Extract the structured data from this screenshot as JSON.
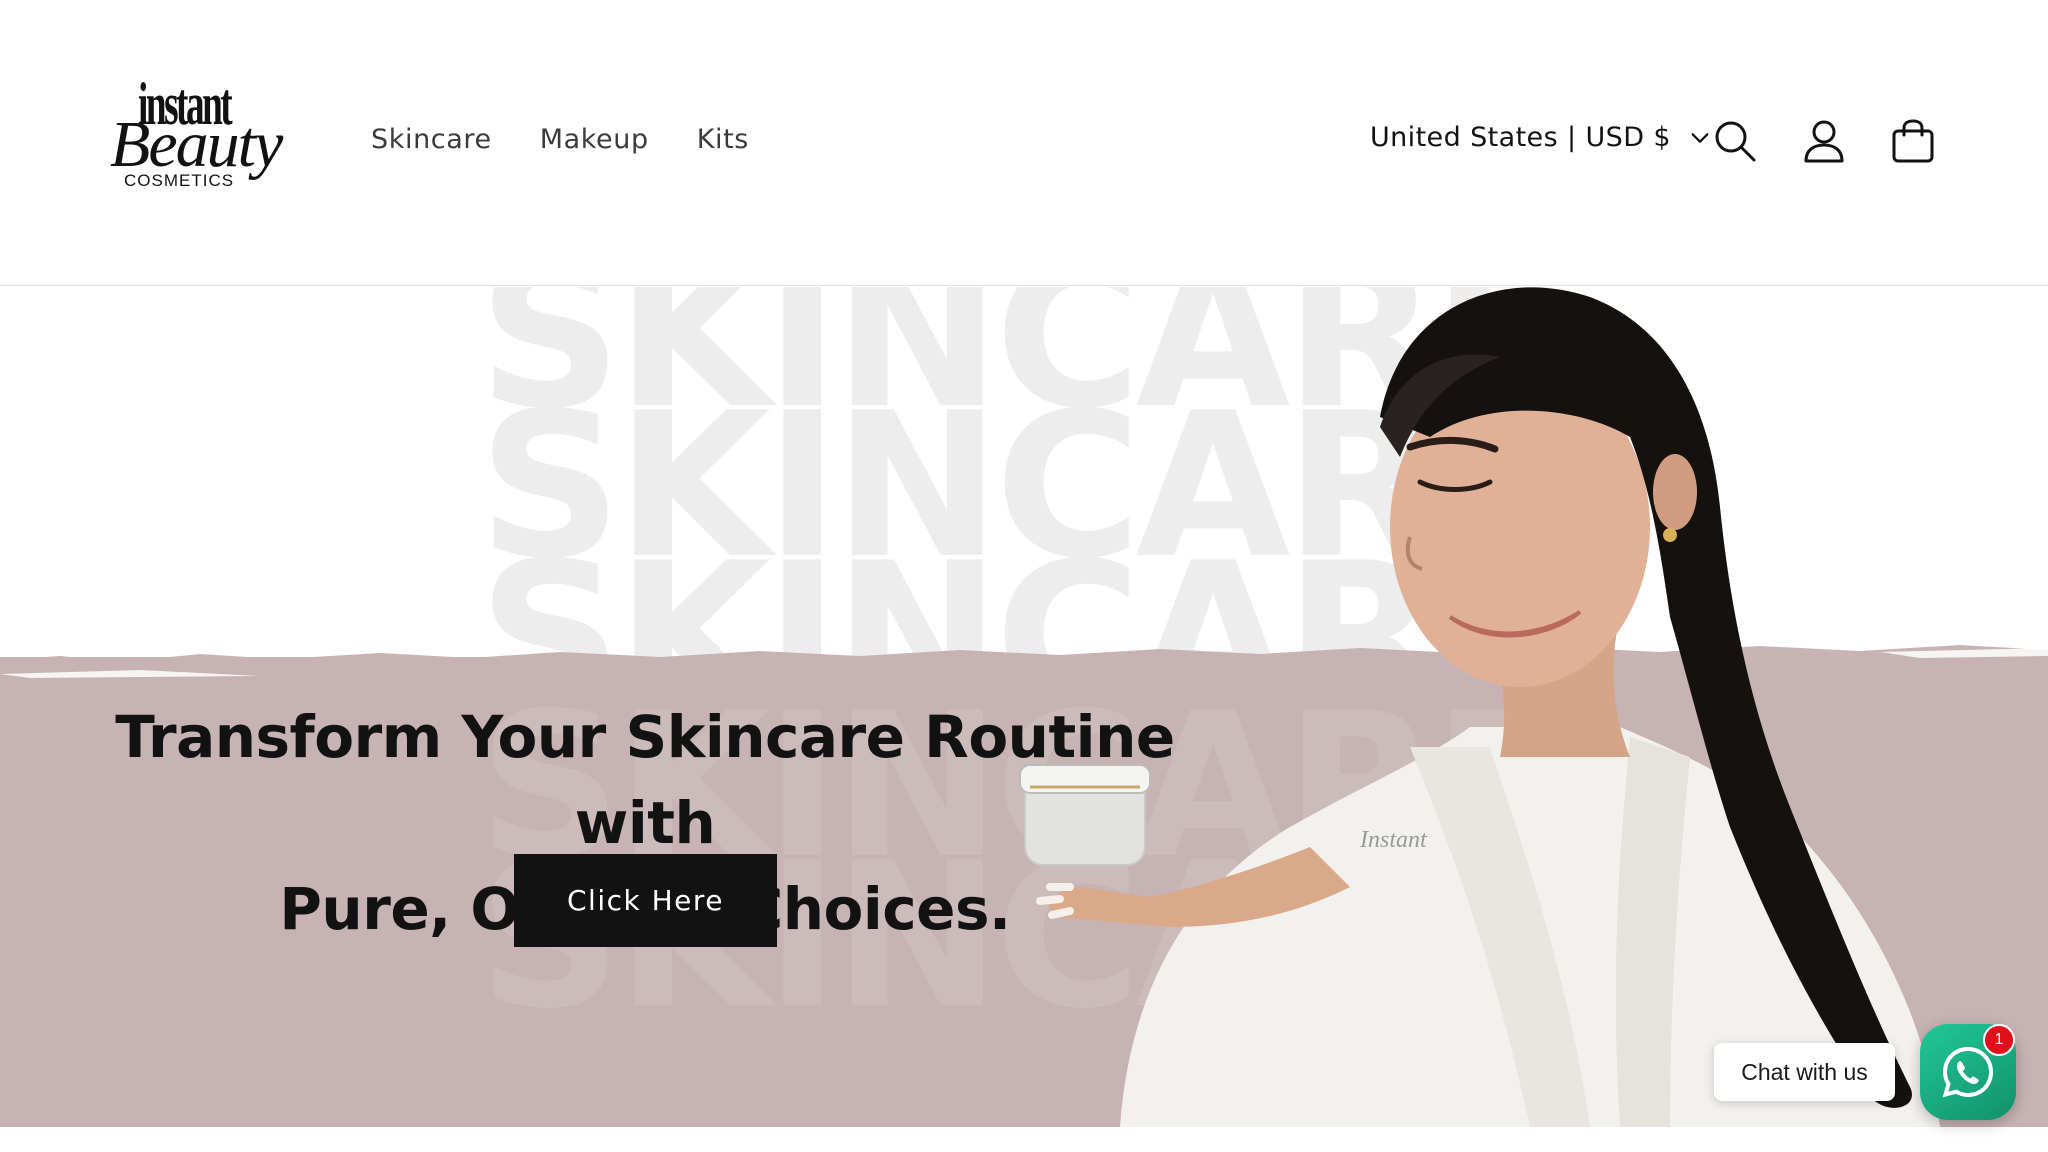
{
  "brand": {
    "logo_line1": "instant",
    "logo_line2": "Beauty",
    "logo_line3": "COSMETICS"
  },
  "nav": {
    "items": [
      {
        "label": "Skincare"
      },
      {
        "label": "Makeup"
      },
      {
        "label": "Kits"
      }
    ]
  },
  "header": {
    "country_selector": "United States | USD $",
    "icons": [
      "search-icon",
      "account-icon",
      "cart-icon"
    ]
  },
  "hero": {
    "watermark_word": "SKINCARE",
    "headline": {
      "part1_bold": "Transform",
      "part2": " Your ",
      "part3_bold": "Skincare",
      "part4": " Routine with",
      "line2_bold": "Pure, Organic Choices."
    },
    "cta_label": "Click Here",
    "band_color": "#c7b3b4"
  },
  "chat": {
    "label": "Chat with us",
    "badge_count": "1",
    "icon": "whatsapp-icon",
    "color": "#20c997"
  }
}
